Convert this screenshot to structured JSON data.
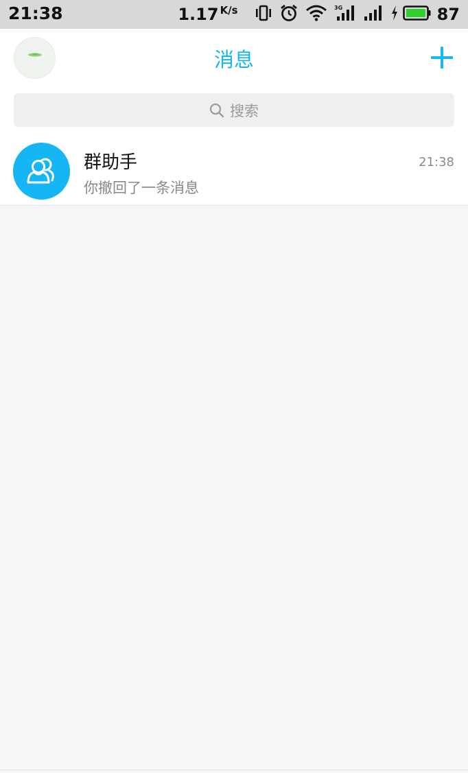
{
  "status_bar": {
    "time": "21:38",
    "net_speed": "1.17",
    "net_unit": "K/s",
    "battery": "87",
    "icons": [
      "vibrate-icon",
      "alarm-icon",
      "wifi-icon",
      "signal-3g-icon",
      "signal-icon",
      "charging-icon",
      "battery-icon"
    ]
  },
  "header": {
    "title": "消息",
    "plus_label": "+"
  },
  "search": {
    "placeholder": "搜索"
  },
  "conversations": [
    {
      "name": "群助手",
      "last_message": "你撤回了一条消息",
      "time": "21:38",
      "avatar_color": "#16b5f4"
    }
  ],
  "colors": {
    "accent": "#12b7f5",
    "background": "#f7f7f9",
    "status_bar": "#d8d8d8"
  }
}
